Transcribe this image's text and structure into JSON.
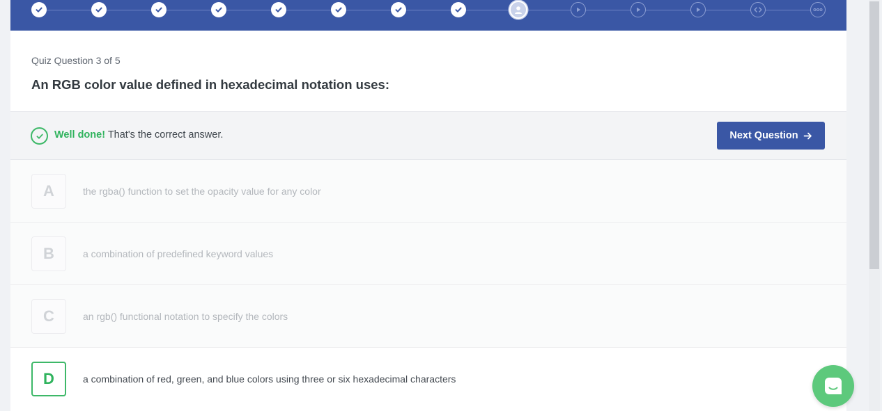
{
  "progress": {
    "steps": [
      {
        "state": "done",
        "icon": "check-icon"
      },
      {
        "state": "done",
        "icon": "check-icon"
      },
      {
        "state": "done",
        "icon": "check-icon"
      },
      {
        "state": "done",
        "icon": "check-icon"
      },
      {
        "state": "done",
        "icon": "check-icon"
      },
      {
        "state": "done",
        "icon": "check-icon"
      },
      {
        "state": "done",
        "icon": "check-icon"
      },
      {
        "state": "done",
        "icon": "check-icon"
      },
      {
        "state": "current",
        "icon": "user-icon"
      },
      {
        "state": "future",
        "icon": "play-icon"
      },
      {
        "state": "future",
        "icon": "play-icon"
      },
      {
        "state": "future",
        "icon": "play-icon"
      },
      {
        "state": "future",
        "icon": "code-icon"
      },
      {
        "state": "future",
        "icon": "more-icon"
      }
    ]
  },
  "quiz": {
    "counter": "Quiz Question 3 of 5",
    "question": "An RGB color value defined in hexadecimal notation uses:"
  },
  "feedback": {
    "strong": "Well done!",
    "message": " That's the correct answer.",
    "next_label": "Next Question"
  },
  "options": [
    {
      "letter": "A",
      "text": "the rgba() function to set the opacity value for any color",
      "correct": false
    },
    {
      "letter": "B",
      "text": "a combination of predefined keyword values",
      "correct": false
    },
    {
      "letter": "C",
      "text": "an rgb() functional notation to specify the colors",
      "correct": false
    },
    {
      "letter": "D",
      "text": "a combination of red, green, and blue colors using three or six hexadecimal characters",
      "correct": true
    }
  ],
  "colors": {
    "brand": "#3a57a5",
    "success": "#2fb35d",
    "chat": "#5dc97c"
  }
}
